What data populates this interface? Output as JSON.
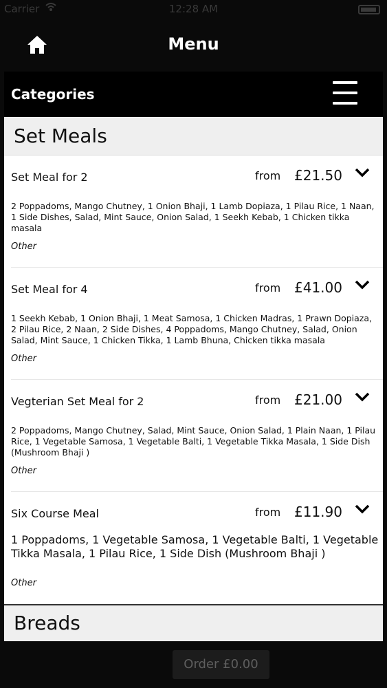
{
  "status_bar": {
    "carrier": "Carrier",
    "time": "12:28 AM"
  },
  "nav": {
    "title": "Menu"
  },
  "categories": {
    "label": "Categories"
  },
  "sections": [
    {
      "title": "Set Meals",
      "items": [
        {
          "name": "Set Meal for 2",
          "from": "from",
          "price": "£21.50",
          "description": "2 Poppadoms, Mango Chutney, 1 Onion Bhaji, 1 Lamb Dopiaza, 1 Pilau Rice, 1 Naan, 1 Side Dishes, Salad, Mint Sauce, Onion Salad, 1 Seekh Kebab, 1 Chicken tikka masala",
          "category": "Other"
        },
        {
          "name": "Set Meal for 4",
          "from": "from",
          "price": "£41.00",
          "description": "1 Seekh Kebab, 1 Onion Bhaji, 1 Meat Samosa, 1 Chicken Madras, 1 Prawn Dopiaza, 2 Pilau Rice, 2 Naan, 2 Side Dishes, 4 Poppadoms, Mango Chutney, Salad, Onion Salad, Mint Sauce, 1 Chicken Tikka, 1 Lamb Bhuna, Chicken tikka masala",
          "category": "Other"
        },
        {
          "name": "Vegterian Set Meal for 2",
          "from": "from",
          "price": "£21.00",
          "description": "2 Poppadoms, Mango Chutney, Salad, Mint Sauce, Onion Salad, 1 Plain Naan, 1 Pilau Rice, 1 Vegetable Samosa, 1 Vegetable Balti, 1 Vegetable Tikka Masala, 1 Side Dish (Mushroom Bhaji )",
          "category": "Other"
        },
        {
          "name": "Six Course Meal",
          "from": "from",
          "price": "£11.90",
          "description": "1 Poppadoms, 1 Vegetable Samosa, 1 Vegetable Balti, 1 Vegetable Tikka Masala, 1 Pilau Rice, 1 Side Dish (Mushroom Bhaji )",
          "category": "Other"
        }
      ]
    },
    {
      "title": "Breads"
    }
  ],
  "order_button": {
    "label": "Order £0.00"
  }
}
